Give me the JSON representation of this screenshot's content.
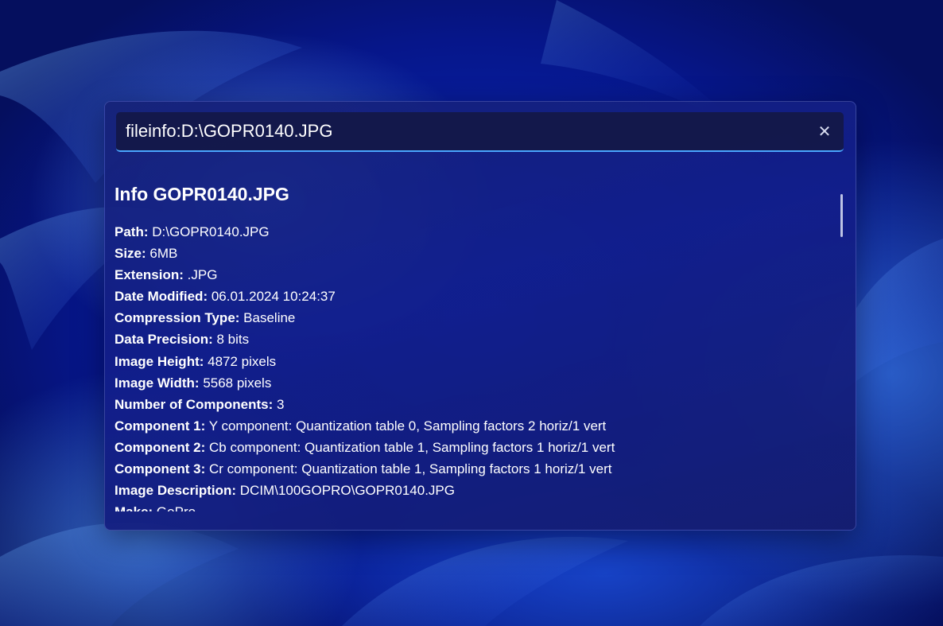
{
  "search": {
    "value": "fileinfo:D:\\GOPR0140.JPG",
    "clear_icon": "close-icon"
  },
  "info": {
    "title": "Info GOPR0140.JPG",
    "properties": [
      {
        "label": "Path:",
        "value": "D:\\GOPR0140.JPG"
      },
      {
        "label": "Size:",
        "value": "6MB"
      },
      {
        "label": "Extension:",
        "value": ".JPG"
      },
      {
        "label": "Date Modified:",
        "value": "06.01.2024 10:24:37"
      },
      {
        "label": "Compression Type:",
        "value": "Baseline"
      },
      {
        "label": "Data Precision:",
        "value": "8 bits"
      },
      {
        "label": "Image Height:",
        "value": "4872 pixels"
      },
      {
        "label": "Image Width:",
        "value": "5568 pixels"
      },
      {
        "label": "Number of Components:",
        "value": "3"
      },
      {
        "label": "Component 1:",
        "value": "Y component: Quantization table 0, Sampling factors 2 horiz/1 vert"
      },
      {
        "label": "Component 2:",
        "value": "Cb component: Quantization table 1, Sampling factors 1 horiz/1 vert"
      },
      {
        "label": "Component 3:",
        "value": "Cr component: Quantization table 1, Sampling factors 1 horiz/1 vert"
      },
      {
        "label": "Image Description:",
        "value": "DCIM\\100GOPRO\\GOPR0140.JPG"
      },
      {
        "label": "Make:",
        "value": "GoPro"
      }
    ]
  },
  "colors": {
    "accent": "#4aa6ff",
    "panel": "#16227a",
    "text": "#ffffff"
  }
}
